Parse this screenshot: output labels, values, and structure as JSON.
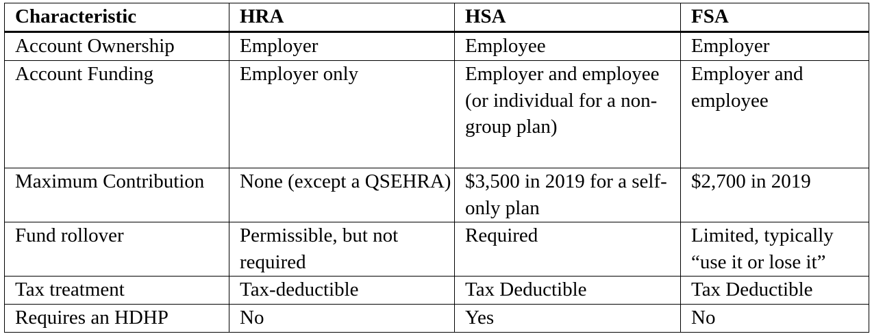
{
  "table": {
    "headers": [
      "Characteristic",
      "HRA",
      "HSA",
      "FSA"
    ],
    "rows": [
      [
        "Account Ownership",
        "Employer",
        "Employee",
        "Employer"
      ],
      [
        "Account Funding",
        "Employer only",
        "Employer and employee (or individual for a non-group plan)",
        "Employer and employee"
      ],
      [
        "Maximum Contribution",
        "None (except a QSEHRA)",
        "$3,500 in 2019 for a self-only plan",
        "$2,700 in 2019"
      ],
      [
        "Fund rollover",
        "Permissible, but not required",
        "Required",
        "Limited, typically “use it or lose it”"
      ],
      [
        "Tax treatment",
        "Tax-deductible",
        "Tax Deductible",
        "Tax Deductible"
      ],
      [
        "Requires an HDHP",
        "No",
        "Yes",
        "No"
      ]
    ]
  }
}
